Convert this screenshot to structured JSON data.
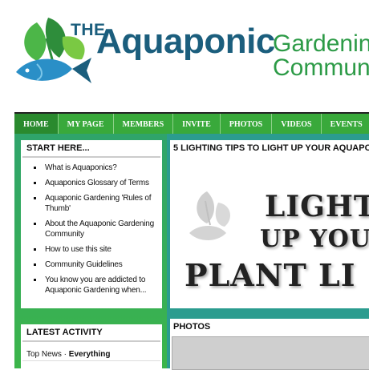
{
  "logo": {
    "the": "THE",
    "aquaponic": "Aquaponic",
    "gardening": "Gardening",
    "community": "Communi"
  },
  "nav": {
    "items": [
      {
        "label": "HOME"
      },
      {
        "label": "MY PAGE"
      },
      {
        "label": "MEMBERS"
      },
      {
        "label": "INVITE"
      },
      {
        "label": "PHOTOS"
      },
      {
        "label": "VIDEOS"
      },
      {
        "label": "EVENTS"
      }
    ]
  },
  "start_here": {
    "title": "START HERE...",
    "links": [
      {
        "label": "What is Aquaponics?"
      },
      {
        "label": "Aquaponics Glossary of Terms"
      },
      {
        "label": "Aquaponic Gardening 'Rules of Thumb'"
      },
      {
        "label": "About the Aquaponic Gardening Community"
      },
      {
        "label": "How to use this site"
      },
      {
        "label": "Community Guidelines"
      },
      {
        "label": "You know you are addicted to Aquaponic Gardening when..."
      }
    ]
  },
  "latest_activity": {
    "title": "LATEST ACTIVITY",
    "filter_prefix": "Top News · ",
    "filter_active": "Everything"
  },
  "feature": {
    "title": "5 LIGHTING TIPS TO LIGHT UP YOUR AQUAPO",
    "image_lines": [
      "LIGHT",
      "UP YOU",
      "PLANT LI"
    ]
  },
  "photos": {
    "title": "PHOTOS"
  },
  "colors": {
    "brand_blue": "#1b5e7d",
    "brand_green": "#2d9b47",
    "nav_green": "#39a93b",
    "teal": "#2b9c8f"
  }
}
